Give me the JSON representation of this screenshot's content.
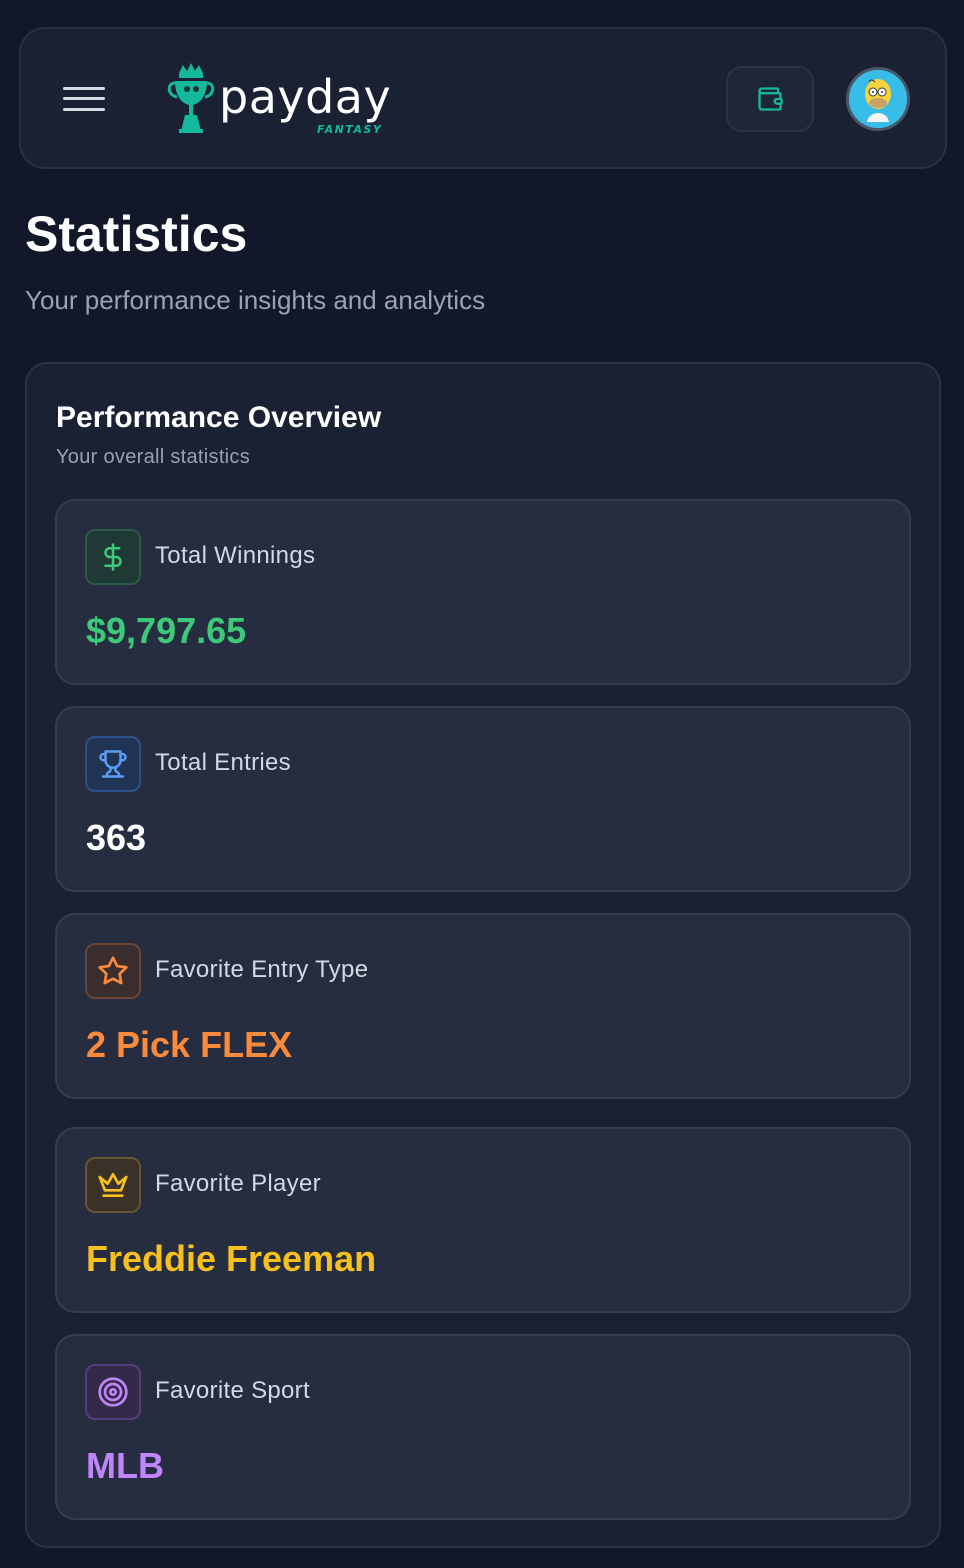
{
  "brand": {
    "name": "payday",
    "tagline": "FANTASY",
    "accent_color": "#14b89a"
  },
  "header": {
    "menu_icon": "hamburger-menu-icon",
    "wallet_icon": "wallet-icon",
    "avatar_icon": "user-avatar"
  },
  "page": {
    "title": "Statistics",
    "subtitle": "Your performance insights and analytics"
  },
  "overview": {
    "title": "Performance Overview",
    "subtitle": "Your overall statistics",
    "cards": [
      {
        "icon": "dollar-icon",
        "label": "Total Winnings",
        "value": "$9,797.65",
        "color": "#3dc97a"
      },
      {
        "icon": "trophy-icon",
        "label": "Total Entries",
        "value": "363",
        "color": "#ffffff"
      },
      {
        "icon": "star-icon",
        "label": "Favorite Entry Type",
        "value": "2 Pick FLEX",
        "color": "#fb8a3c"
      },
      {
        "icon": "crown-icon",
        "label": "Favorite Player",
        "value": "Freddie Freeman",
        "color": "#f7c01c"
      },
      {
        "icon": "target-icon",
        "label": "Favorite Sport",
        "value": "MLB",
        "color": "#c084fc"
      }
    ]
  }
}
